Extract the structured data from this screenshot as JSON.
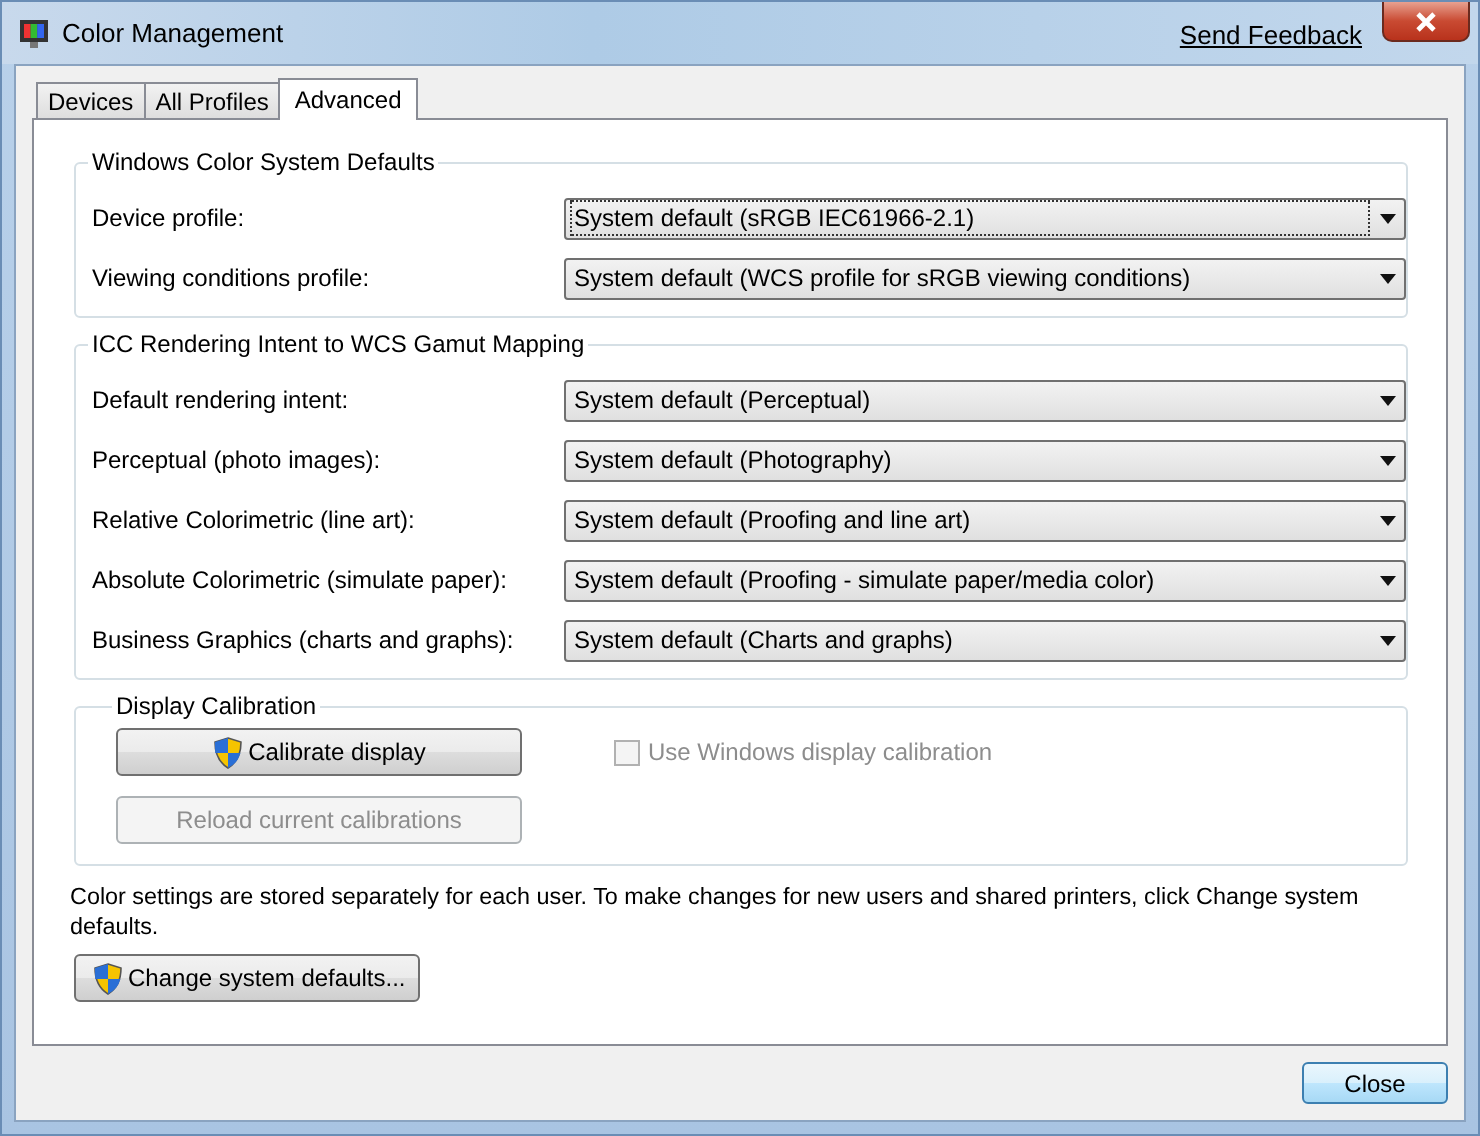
{
  "window": {
    "title": "Color Management",
    "link": "Send Feedback"
  },
  "tabs": [
    {
      "label": "Devices",
      "selected": false
    },
    {
      "label": "All Profiles",
      "selected": false
    },
    {
      "label": "Advanced",
      "selected": true
    }
  ],
  "groups": [
    {
      "title": "Windows Color System Defaults",
      "rows": [
        {
          "label": "Device profile:",
          "value": "System default (sRGB IEC61966-2.1)",
          "focused": true
        },
        {
          "label": "Viewing conditions profile:",
          "value": "System default (WCS profile for sRGB viewing conditions)",
          "focused": false
        }
      ]
    },
    {
      "title": "ICC Rendering Intent to WCS Gamut Mapping",
      "rows": [
        {
          "label": "Default rendering intent:",
          "value": "System default (Perceptual)",
          "focused": false
        },
        {
          "label": "Perceptual (photo images):",
          "value": "System default (Photography)",
          "focused": false
        },
        {
          "label": "Relative Colorimetric (line art):",
          "value": "System default (Proofing and line art)",
          "focused": false
        },
        {
          "label": "Absolute Colorimetric (simulate paper):",
          "value": "System default (Proofing - simulate paper/media color)",
          "focused": false
        },
        {
          "label": "Business Graphics (charts and graphs):",
          "value": "System default (Charts and graphs)",
          "focused": false
        }
      ]
    }
  ],
  "calibration": {
    "title": "Display Calibration",
    "buttons": [
      {
        "label": "Calibrate display",
        "shield": true,
        "disabled": false
      },
      {
        "label": "Reload current calibrations",
        "shield": false,
        "disabled": true
      }
    ],
    "checkbox": {
      "label": "Use Windows display calibration",
      "checked": false,
      "disabled": true
    }
  },
  "note": "Color settings are stored separately for each user. To make changes for new users and shared printers, click Change system defaults.",
  "change_button": {
    "label": "Change system defaults...",
    "shield": true
  },
  "close_button": "Close"
}
